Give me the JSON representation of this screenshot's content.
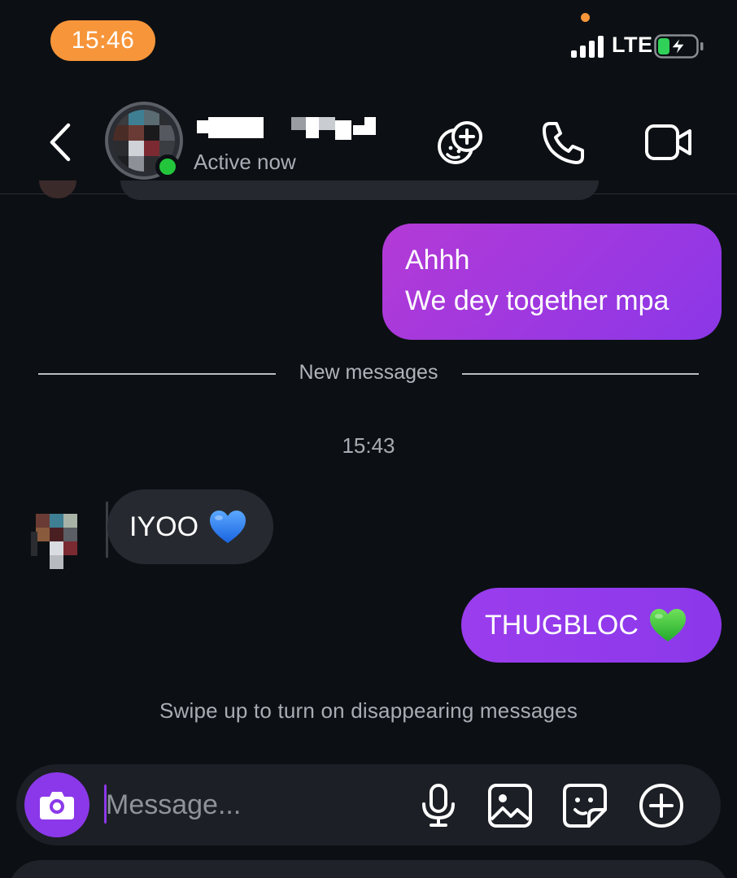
{
  "status_bar": {
    "time": "15:46",
    "network": "LTE",
    "accent_color": "#f7953a"
  },
  "header": {
    "contact_status": "Active now",
    "icons": [
      "back-icon",
      "avatar",
      "online-dot",
      "add-people-icon",
      "phone-icon",
      "video-icon"
    ]
  },
  "messages": {
    "outgoing_1": {
      "line1": "Ahhh",
      "line2": "We dey together mpa"
    },
    "divider": "New messages",
    "timestamp": "15:43",
    "incoming_1": {
      "text": "IYOO",
      "emoji": "blue-heart"
    },
    "outgoing_2": {
      "text": "THUGBLOC",
      "emoji": "green-heart"
    },
    "hint": "Swipe up to turn on disappearing messages"
  },
  "composer": {
    "placeholder": "Message...",
    "accent": "#8b38ea",
    "icons": [
      "camera-icon",
      "microphone-icon",
      "gallery-icon",
      "sticker-icon",
      "plus-icon"
    ]
  }
}
